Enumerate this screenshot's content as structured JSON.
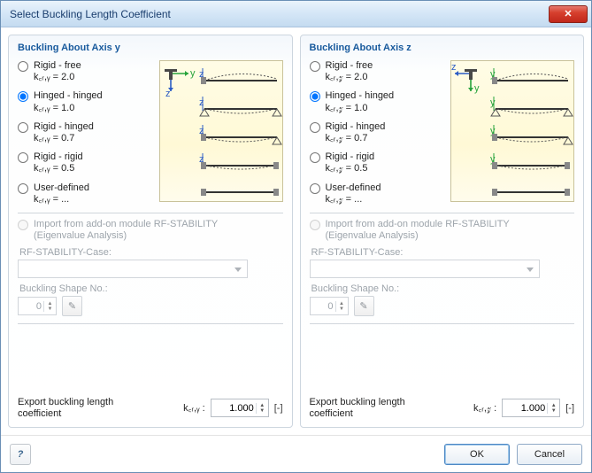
{
  "window": {
    "title": "Select Buckling Length Coefficient"
  },
  "panels": {
    "y": {
      "title": "Buckling About Axis y",
      "options": {
        "rigid_free": {
          "label": "Rigid - free",
          "sub": "k꜀ᵣ,ᵧ = 2.0"
        },
        "hinged_hinged": {
          "label": "Hinged - hinged",
          "sub": "k꜀ᵣ,ᵧ = 1.0"
        },
        "rigid_hinged": {
          "label": "Rigid - hinged",
          "sub": "k꜀ᵣ,ᵧ = 0.7"
        },
        "rigid_rigid": {
          "label": "Rigid - rigid",
          "sub": "k꜀ᵣ,ᵧ = 0.5"
        },
        "user": {
          "label": "User-defined",
          "sub": "k꜀ᵣ,ᵧ = ..."
        }
      },
      "selected": "hinged_hinged",
      "import_label": "Import from add-on module RF-STABILITY\n(Eigenvalue Analysis)",
      "case_label": "RF-STABILITY-Case:",
      "shape_label": "Buckling Shape No.:",
      "shape_value": "0",
      "export_label": "Export buckling length coefficient",
      "kcr_symbol": "k꜀ᵣ,ᵧ :",
      "kcr_value": "1.000",
      "unit": "[-]"
    },
    "z": {
      "title": "Buckling About Axis z",
      "options": {
        "rigid_free": {
          "label": "Rigid - free",
          "sub": "k꜀ᵣ,𝓏 = 2.0"
        },
        "hinged_hinged": {
          "label": "Hinged - hinged",
          "sub": "k꜀ᵣ,𝓏 = 1.0"
        },
        "rigid_hinged": {
          "label": "Rigid - hinged",
          "sub": "k꜀ᵣ,𝓏 = 0.7"
        },
        "rigid_rigid": {
          "label": "Rigid - rigid",
          "sub": "k꜀ᵣ,𝓏 = 0.5"
        },
        "user": {
          "label": "User-defined",
          "sub": "k꜀ᵣ,𝓏 = ..."
        }
      },
      "selected": "hinged_hinged",
      "import_label": "Import from add-on module RF-STABILITY\n(Eigenvalue Analysis)",
      "case_label": "RF-STABILITY-Case:",
      "shape_label": "Buckling Shape No.:",
      "shape_value": "0",
      "export_label": "Export buckling length coefficient",
      "kcr_symbol": "k꜀ᵣ,𝓏 :",
      "kcr_value": "1.000",
      "unit": "[-]"
    }
  },
  "buttons": {
    "ok": "OK",
    "cancel": "Cancel",
    "close": "✕"
  }
}
